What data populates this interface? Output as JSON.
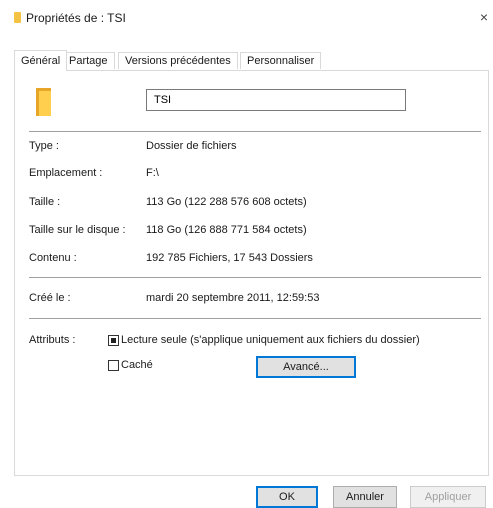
{
  "window": {
    "title": "Propriétés de : TSI",
    "close_glyph": "×"
  },
  "tabs": [
    {
      "label": "Général",
      "active": true
    },
    {
      "label": "Partage",
      "active": false
    },
    {
      "label": "Versions précédentes",
      "active": false
    },
    {
      "label": "Personnaliser",
      "active": false
    }
  ],
  "folder": {
    "icon": "folder-icon",
    "name": "TSI"
  },
  "properties": {
    "type": {
      "label": "Type :",
      "value": "Dossier de fichiers"
    },
    "location": {
      "label": "Emplacement :",
      "value": "F:\\"
    },
    "size": {
      "label": "Taille :",
      "value": "113 Go (122 288 576 608 octets)"
    },
    "size_on_disk": {
      "label": "Taille sur le disque :",
      "value": "118 Go (126 888 771 584 octets)"
    },
    "contents": {
      "label": "Contenu :",
      "value": "192 785 Fichiers, 17 543 Dossiers"
    },
    "created": {
      "label": "Créé le :",
      "value": "mardi 20 septembre 2011, 12:59:53"
    }
  },
  "attributes": {
    "label": "Attributs :",
    "read_only": {
      "label": "Lecture seule (s'applique uniquement aux fichiers du dossier)",
      "state": "indeterminate"
    },
    "hidden": {
      "label": "Caché",
      "checked": false
    },
    "advanced_label": "Avancé..."
  },
  "buttons": {
    "ok": "OK",
    "cancel": "Annuler",
    "apply": "Appliquer"
  },
  "colors": {
    "accent": "#0078d7",
    "folder": "#ffcf4d",
    "separator": "#a0a0a0"
  }
}
